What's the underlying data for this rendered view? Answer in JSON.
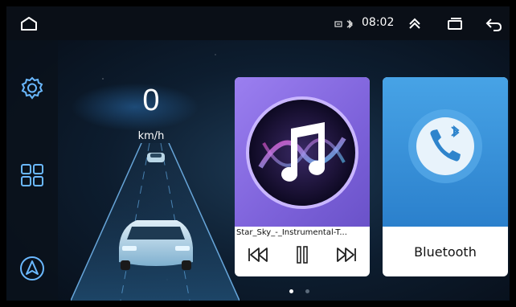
{
  "status_bar": {
    "time": "08:02",
    "icons": [
      "home-icon",
      "signal-icon",
      "bluetooth-icon",
      "chevrons-up-icon",
      "recent-apps-icon",
      "back-icon"
    ]
  },
  "dock": {
    "items": [
      {
        "icon": "gear-icon",
        "label": ""
      },
      {
        "icon": "grid-apps-icon",
        "label": ""
      },
      {
        "icon": "navigation-icon",
        "label": ""
      }
    ]
  },
  "gauge": {
    "speed": "0",
    "unit": "km/h"
  },
  "music_card": {
    "track": "Star_Sky_-_Instrumental-T...",
    "controls": [
      "previous-icon",
      "pause-icon",
      "next-icon"
    ]
  },
  "bluetooth_card": {
    "label": "Bluetooth"
  },
  "pager": {
    "pages": 2,
    "active": 1
  },
  "colors": {
    "music_accent": "#8b6fe8",
    "bluetooth_accent": "#3a93dc",
    "icon_color": "#6ab8ff"
  }
}
